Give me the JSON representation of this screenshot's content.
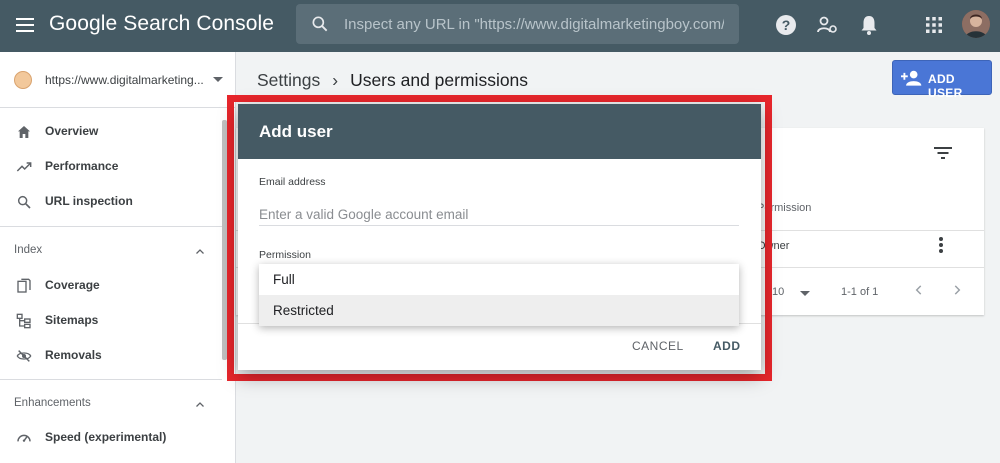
{
  "topbar": {
    "brand": "Google Search Console",
    "search_placeholder": "Inspect any URL in \"https://www.digitalmarketingboy.com/\""
  },
  "sidebar": {
    "property_url": "https://www.digitalmarketing...",
    "nav_top": [
      {
        "label": "Overview",
        "icon": "home-icon"
      },
      {
        "label": "Performance",
        "icon": "trending-up-icon"
      },
      {
        "label": "URL inspection",
        "icon": "search-icon"
      }
    ],
    "index_section": "Index",
    "index_items": [
      {
        "label": "Coverage",
        "icon": "file-copy-icon"
      },
      {
        "label": "Sitemaps",
        "icon": "sitemap-icon"
      },
      {
        "label": "Removals",
        "icon": "visibility-off-icon"
      }
    ],
    "enhancements_section": "Enhancements",
    "enhancement_items": [
      {
        "label": "Speed (experimental)",
        "icon": "speed-icon"
      }
    ]
  },
  "main": {
    "breadcrumb_parent": "Settings",
    "breadcrumb_sep": "›",
    "breadcrumb_current": "Users and permissions",
    "add_user_label": "ADD USER",
    "table": {
      "permission_header": "Permission",
      "row_permission": "Owner",
      "rows_per_page": "10",
      "range": "1-1 of 1"
    }
  },
  "dialog": {
    "title": "Add user",
    "email_label": "Email address",
    "email_placeholder": "Enter a valid Google account email",
    "permission_label": "Permission",
    "options": [
      "Full",
      "Restricted"
    ],
    "highlighted_option": "Restricted",
    "cancel_label": "CANCEL",
    "add_label": "ADD"
  },
  "colors": {
    "topbar": "#455a64",
    "accent_button": "#4a76d6",
    "highlight_border": "#e8262c"
  }
}
